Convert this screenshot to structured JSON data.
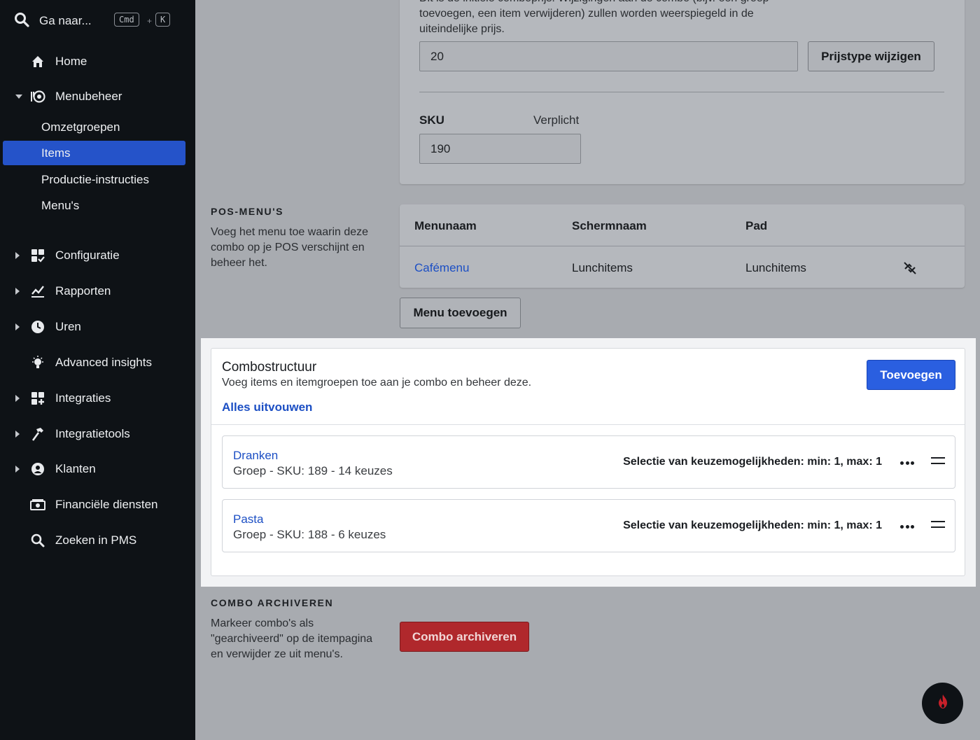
{
  "sidebar": {
    "search": {
      "label": "Ga naar...",
      "kbd1": "Cmd",
      "plus": "+",
      "kbd2": "K"
    },
    "items": [
      {
        "label": "Home",
        "icon": "home-icon"
      },
      {
        "label": "Menubeheer",
        "icon": "menu-management-icon",
        "expanded": true
      },
      {
        "label": "Configuratie",
        "icon": "configuration-icon"
      },
      {
        "label": "Rapporten",
        "icon": "reports-icon"
      },
      {
        "label": "Uren",
        "icon": "clock-icon"
      },
      {
        "label": "Advanced insights",
        "icon": "lightbulb-icon"
      },
      {
        "label": "Integraties",
        "icon": "integrations-icon"
      },
      {
        "label": "Integratietools",
        "icon": "hammer-icon"
      },
      {
        "label": "Klanten",
        "icon": "customers-icon"
      },
      {
        "label": "Financiële diensten",
        "icon": "cash-icon"
      },
      {
        "label": "Zoeken in PMS",
        "icon": "search-icon"
      }
    ],
    "subitems": [
      {
        "label": "Omzetgroepen"
      },
      {
        "label": "Items",
        "active": true
      },
      {
        "label": "Productie-instructies"
      },
      {
        "label": "Menu's"
      }
    ]
  },
  "price": {
    "description": "Dit is de initiële comboprijs. Wijzigingen aan de combo (bijv. een groep toevoegen, een item verwijderen) zullen worden weerspiegeld in de uiteindelijke prijs.",
    "value": "20",
    "change_button": "Prijstype wijzigen"
  },
  "sku": {
    "label": "SKU",
    "required": "Verplicht",
    "value": "190"
  },
  "pos_menus": {
    "section_label": "POS-MENU'S",
    "description": "Voeg het menu toe waarin deze combo op je POS verschijnt en beheer het.",
    "columns": [
      "Menunaam",
      "Schermnaam",
      "Pad"
    ],
    "rows": [
      {
        "menu": "Cafémenu",
        "screen": "Lunchitems",
        "path": "Lunchitems"
      }
    ],
    "add_button": "Menu toevoegen"
  },
  "combo": {
    "title": "Combostructuur",
    "subtitle": "Voeg items en itemgroepen toe aan je combo en beheer deze.",
    "expand_all": "Alles uitvouwen",
    "add_button": "Toevoegen",
    "groups": [
      {
        "name": "Dranken",
        "meta": "Groep - SKU: 189 - 14 keuzes",
        "selection": "Selectie van keuzemogelijkheden: min: 1, max: 1"
      },
      {
        "name": "Pasta",
        "meta": "Groep - SKU: 188 - 6 keuzes",
        "selection": "Selectie van keuzemogelijkheden: min: 1, max: 1"
      }
    ]
  },
  "archive": {
    "section_label": "COMBO ARCHIVEREN",
    "description": "Markeer combo's als \"gearchiveerd\" op de itempagina en verwijder ze uit menu's.",
    "button": "Combo archiveren"
  },
  "colors": {
    "accent": "#2a5fe0",
    "sidebar_bg": "#0e1216",
    "active_item": "#2553c9",
    "danger": "#b0282c",
    "link": "#1c4fc4"
  }
}
